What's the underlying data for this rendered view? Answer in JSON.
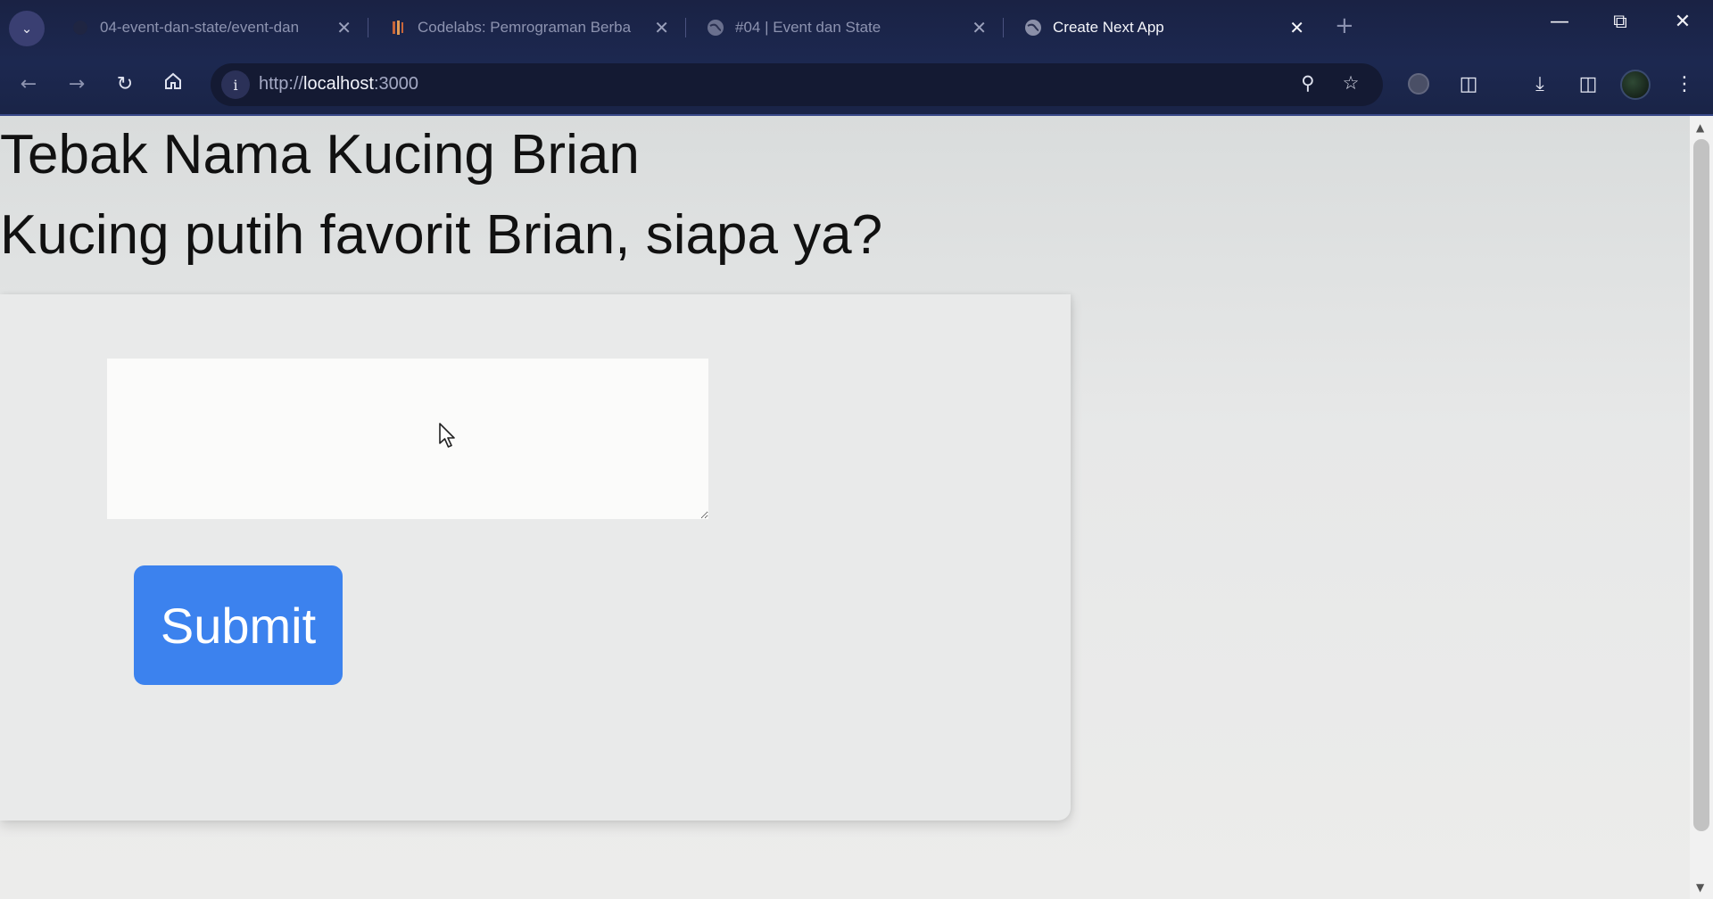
{
  "browser": {
    "tabs": [
      {
        "label": "04-event-dan-state/event-dan",
        "favicon": "github-icon",
        "active": false
      },
      {
        "label": "Codelabs: Pemrograman Berba",
        "favicon": "codelabs-icon",
        "active": false
      },
      {
        "label": "#04 | Event dan State",
        "favicon": "globe-icon",
        "active": false
      },
      {
        "label": "Create Next App",
        "favicon": "globe-icon",
        "active": true
      }
    ],
    "address": {
      "scheme": "http://",
      "host": "localhost",
      "port": ":3000"
    }
  },
  "page": {
    "title": "Tebak Nama Kucing Brian",
    "question": "Kucing putih favorit Brian, siapa ya?",
    "answer_value": "",
    "submit_label": "Submit"
  },
  "colors": {
    "submit_bg": "#3c82ee",
    "chrome_bg": "#1c2850"
  }
}
